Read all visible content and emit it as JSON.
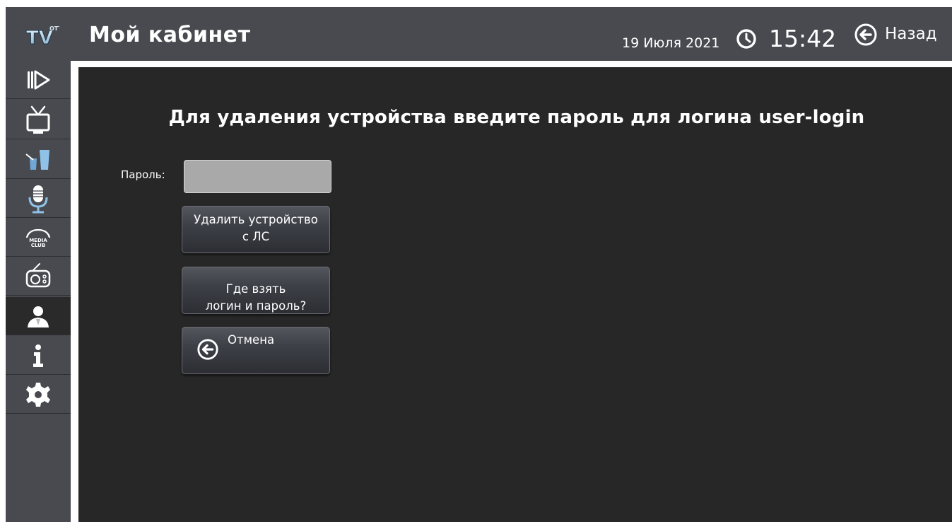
{
  "header": {
    "logo_text": "TV OTT",
    "title": "Мой кабинет",
    "date": "19 Июля 2021",
    "time": "15:42",
    "back_label": "Назад"
  },
  "sidebar": {
    "items": [
      {
        "icon": "play-forward-icon"
      },
      {
        "icon": "tv-icon"
      },
      {
        "icon": "drinks-icon"
      },
      {
        "icon": "microphone-icon"
      },
      {
        "icon": "mediaclub-icon"
      },
      {
        "icon": "radio-icon"
      },
      {
        "icon": "user-icon",
        "active": true
      },
      {
        "icon": "info-icon"
      },
      {
        "icon": "gear-icon"
      }
    ]
  },
  "main": {
    "heading": "Для удаления устройства введите пароль для логина user-login",
    "password_label": "Пароль:",
    "password_value": "",
    "delete_button": {
      "line1": "Удалить устройство",
      "line2": "с ЛС"
    },
    "where_button": {
      "line1": "Где взять",
      "line2": "логин и пароль?"
    },
    "cancel_button": {
      "label": "Отмена"
    }
  }
}
